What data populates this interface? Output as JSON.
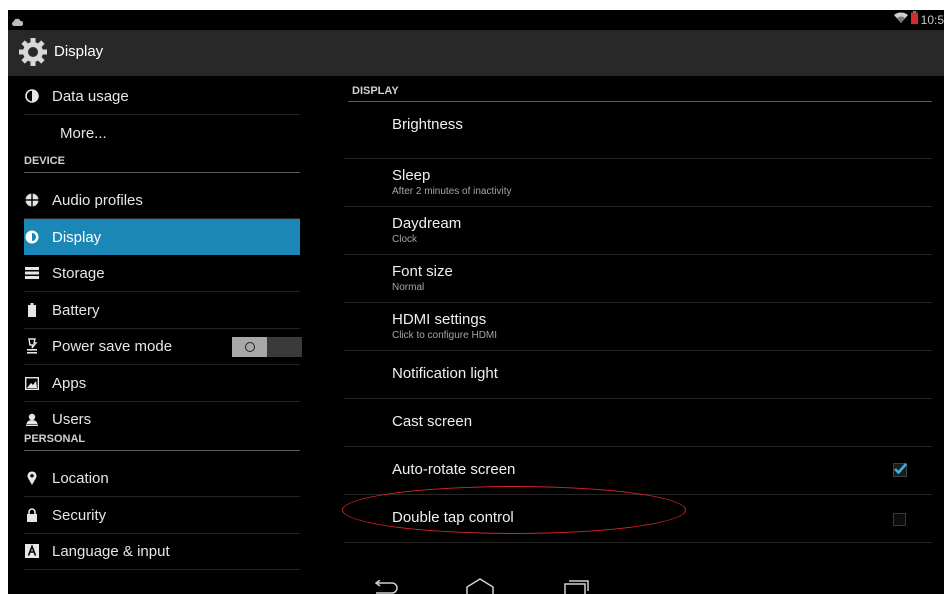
{
  "status_bar": {
    "time": "10:5",
    "notification_icon": "cloud-icon",
    "wifi_icon": "wifi-icon",
    "battery_icon": "battery-low-icon",
    "battery_color": "#d62a2a"
  },
  "action_bar": {
    "title": "Display",
    "icon": "settings-gear-icon"
  },
  "sidebar": {
    "items_top": [
      {
        "label": "Data usage",
        "icon": "data-usage-icon"
      },
      {
        "label": "More..."
      }
    ],
    "device_header": "DEVICE",
    "device_items": [
      {
        "label": "Audio profiles",
        "icon": "audio-profiles-icon"
      },
      {
        "label": "Display",
        "icon": "display-brightness-icon",
        "selected": true
      },
      {
        "label": "Storage",
        "icon": "storage-icon"
      },
      {
        "label": "Battery",
        "icon": "battery-icon"
      },
      {
        "label": "Power save mode",
        "icon": "power-save-icon",
        "toggle_state": "off"
      },
      {
        "label": "Apps",
        "icon": "apps-icon"
      },
      {
        "label": "Users",
        "icon": "users-icon"
      }
    ],
    "personal_header": "PERSONAL",
    "personal_items": [
      {
        "label": "Location",
        "icon": "location-pin-icon"
      },
      {
        "label": "Security",
        "icon": "lock-icon"
      },
      {
        "label": "Language & input",
        "icon": "keyboard-a-icon"
      }
    ],
    "selected_color": "#1b87b6"
  },
  "display_panel": {
    "header": "DISPLAY",
    "items": [
      {
        "title": "Brightness"
      },
      {
        "title": "Sleep",
        "summary": "After 2 minutes of inactivity"
      },
      {
        "title": "Daydream",
        "summary": "Clock"
      },
      {
        "title": "Font size",
        "summary": "Normal"
      },
      {
        "title": "HDMI settings",
        "summary": "Click to configure HDMI"
      },
      {
        "title": "Notification light"
      },
      {
        "title": "Cast screen"
      },
      {
        "title": "Auto-rotate screen",
        "checked": true
      },
      {
        "title": "Double tap control",
        "checked": false
      }
    ],
    "check_color": "#33b5e5",
    "highlight_color": "#d4232b"
  },
  "nav_bar": {
    "back_icon": "back-icon",
    "home_icon": "home-icon",
    "recents_icon": "recent-apps-icon"
  }
}
